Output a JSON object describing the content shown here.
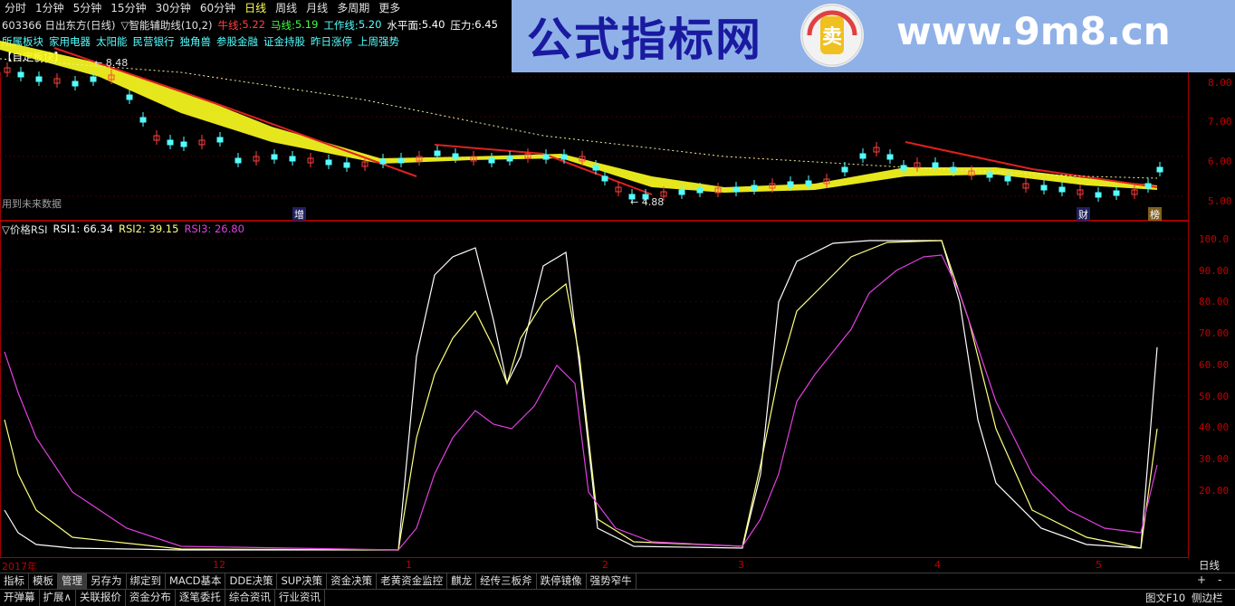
{
  "toolbar": {
    "periods": [
      "分时",
      "1分钟",
      "5分钟",
      "15分钟",
      "30分钟",
      "60分钟",
      "日线",
      "周线",
      "月线",
      "多周期",
      "更多"
    ],
    "active": "日线"
  },
  "info": {
    "stock": "603366 日出东方(日线)",
    "indicator": "▽智能辅助线(10,2)",
    "niu_label": "牛线:",
    "niu_value": "5.22",
    "ma_label": "马线:",
    "ma_value": "5.19",
    "work_label": "工作线:",
    "work_value": "5.20",
    "level_label": "水平面:",
    "level_value": "5.40",
    "pressure_label": "压力:",
    "pressure_value": "6.45"
  },
  "sectors": [
    "所属板块",
    "家用电器",
    "太阳能",
    "民营银行",
    "独角兽",
    "参股金融",
    "证金持股",
    "昨日涨停",
    "上周强势"
  ],
  "custom_board": "【自定板块】",
  "banner": {
    "title": "公式指标网",
    "url": "www.9m8.cn",
    "logo_text": "卖"
  },
  "price_chart": {
    "y_ticks": [
      "8.00",
      "7.00",
      "6.00",
      "5.00"
    ],
    "high_label": "8.48",
    "low_label": "4.88",
    "future_note": "用到未来数据",
    "marks": [
      "增",
      "财",
      "榜"
    ]
  },
  "rsi_chart": {
    "title": "▽价格RSI",
    "rsi1_label": "RSI1: 66.34",
    "rsi2_label": "RSI2: 39.15",
    "rsi3_label": "RSI3: 26.80",
    "y_ticks": [
      "100.0",
      "90.00",
      "80.00",
      "70.00",
      "60.00",
      "50.00",
      "40.00",
      "30.00",
      "20.00"
    ],
    "colors": {
      "rsi1": "#ffffff",
      "rsi2": "#ffff80",
      "rsi3": "#e040e0"
    }
  },
  "dates": [
    "2017年",
    "12",
    "1",
    "2",
    "3",
    "4",
    "5"
  ],
  "period_label": "日线",
  "bottom_tabs_row1": [
    "指标",
    "模板",
    "管理",
    "另存为",
    "绑定到",
    "MACD基本",
    "DDE决策",
    "SUP决策",
    "资金决策",
    "老黄资金监控",
    "麒龙",
    "经传三板斧",
    "跌停镜像",
    "强势窄牛"
  ],
  "bottom_tabs_row2": [
    "开弹幕",
    "扩展∧",
    "关联报价",
    "资金分布",
    "逐笔委托",
    "综合资讯",
    "行业资讯"
  ],
  "bottom_right": [
    "+",
    "-",
    "图文F10",
    "侧边栏"
  ]
}
